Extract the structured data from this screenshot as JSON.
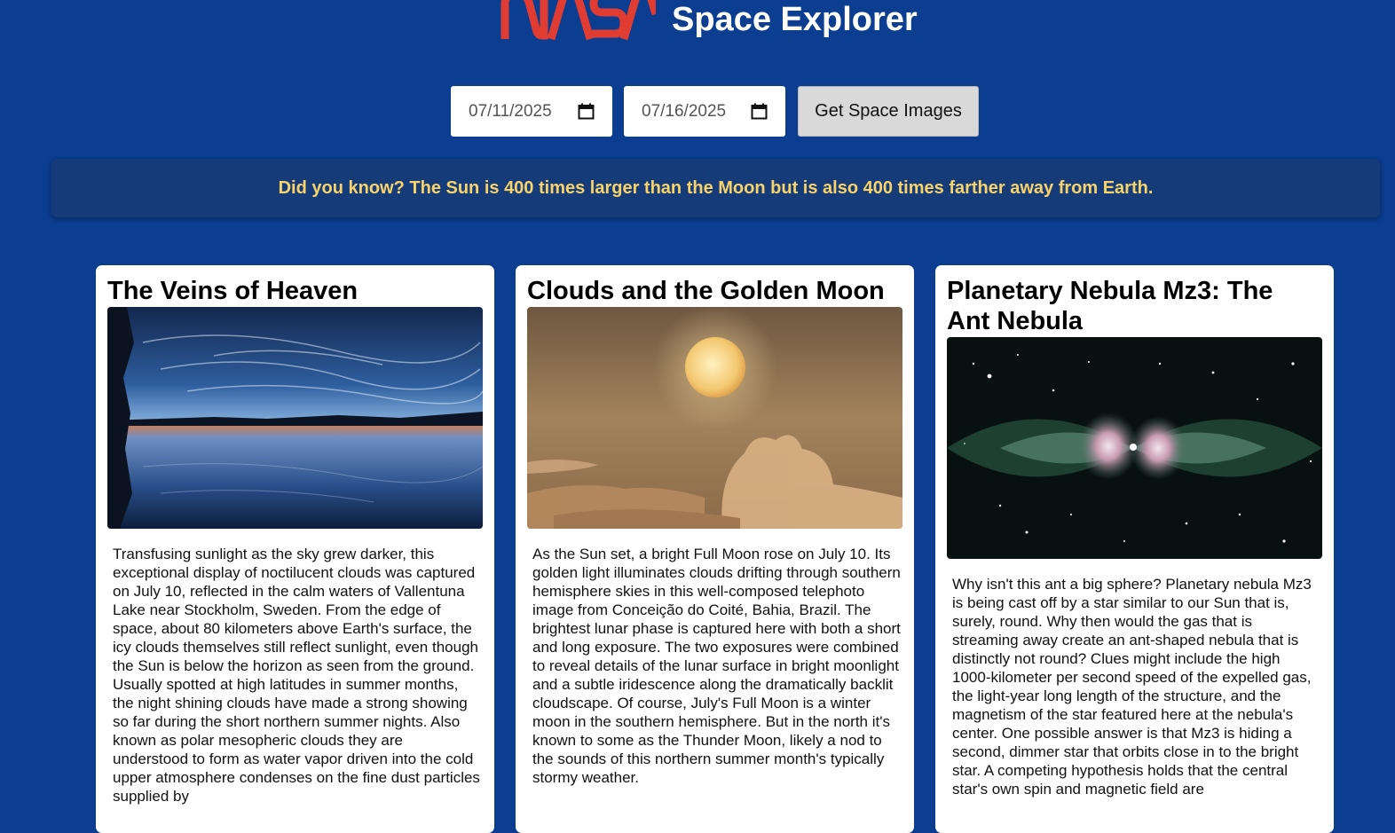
{
  "header": {
    "logo_text": "NASA",
    "title": "Space Explorer"
  },
  "controls": {
    "start_date": "07/11/2025",
    "end_date": "07/16/2025",
    "button_label": "Get Space Images"
  },
  "fact": {
    "text": "Did you know? The Sun is 400 times larger than the Moon but is also 400 times farther away from Earth."
  },
  "cards": [
    {
      "title": "The Veins of Heaven",
      "image_alt": "Noctilucent clouds reflected in a calm lake at dusk",
      "description": "Transfusing sunlight as the sky grew darker, this exceptional display of noctilucent clouds was captured on July 10, reflected in the calm waters of Vallentuna Lake near Stockholm, Sweden. From the edge of space, about 80 kilometers above Earth's surface, the icy clouds themselves still reflect sunlight, even though the Sun is below the horizon as seen from the ground. Usually spotted at high latitudes in summer months, the night shining clouds have made a strong showing so far during the short northern summer nights. Also known as polar mesopheric clouds they are understood to form as water vapor driven into the cold upper atmosphere condenses on the fine dust particles supplied by"
    },
    {
      "title": "Clouds and the Golden Moon",
      "image_alt": "Golden full moon above backlit clouds",
      "description": "As the Sun set, a bright Full Moon rose on July 10. Its golden light illuminates clouds drifting through southern hemisphere skies in this well-composed telephoto image from Conceição do Coité, Bahia, Brazil. The brightest lunar phase is captured here with both a short and long exposure. The two exposures were combined to reveal details of the lunar surface in bright moonlight and a subtle iridescence along the dramatically backlit cloudscape. Of course, July's Full Moon is a winter moon in the southern hemisphere. But in the north it's known to some as the Thunder Moon, likely a nod to the sounds of this northern summer month's typically stormy weather."
    },
    {
      "title": "Planetary Nebula Mz3: The Ant Nebula",
      "image_alt": "The Ant Nebula Mz3 in a star field",
      "description": "Why isn't this ant a big sphere? Planetary nebula Mz3 is being cast off by a star similar to our Sun that is, surely, round. Why then would the gas that is streaming away create an ant-shaped nebula that is distinctly not round? Clues might include the high 1000-kilometer per second speed of the expelled gas, the light-year long length of the structure, and the magnetism of the star featured here at the nebula's center. One possible answer is that Mz3 is hiding a second, dimmer star that orbits close in to the bright star. A competing hypothesis holds that the central star's own spin and magnetic field are"
    }
  ]
}
